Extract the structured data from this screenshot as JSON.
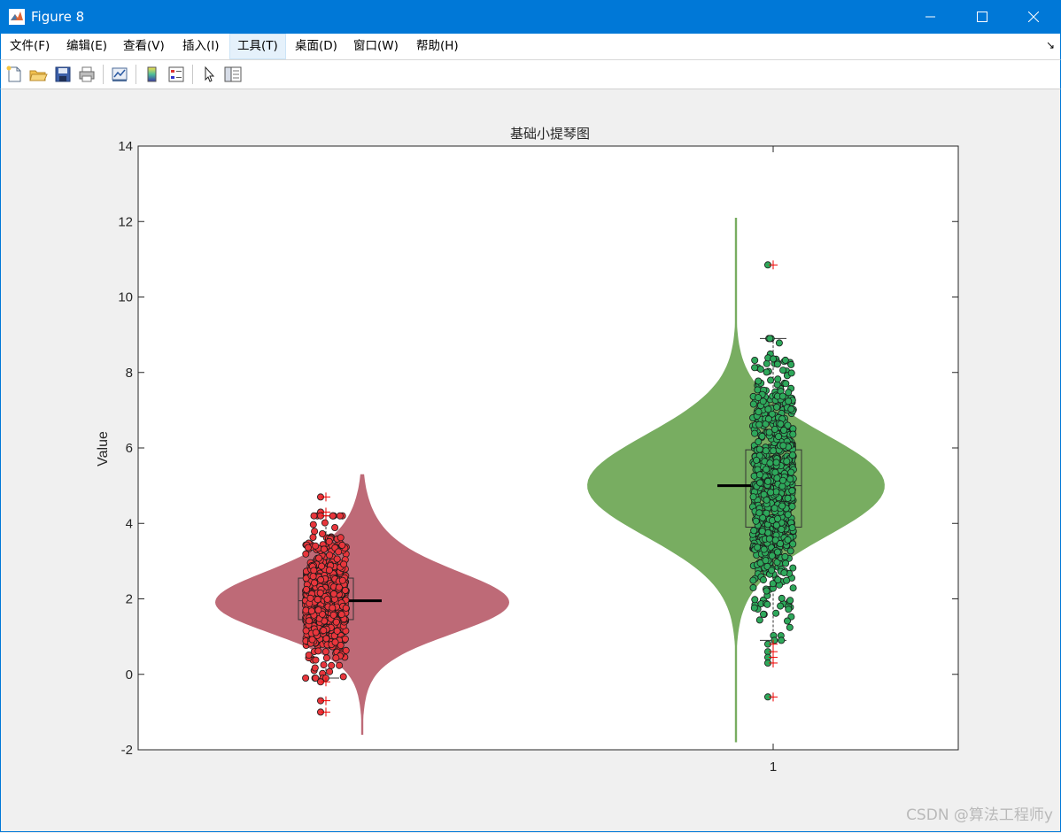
{
  "window": {
    "title": "Figure 8"
  },
  "menu": {
    "items": [
      {
        "label": "文件(F)"
      },
      {
        "label": "编辑(E)"
      },
      {
        "label": "查看(V)"
      },
      {
        "label": "插入(I)"
      },
      {
        "label": "工具(T)",
        "active": true
      },
      {
        "label": "桌面(D)"
      },
      {
        "label": "窗口(W)"
      },
      {
        "label": "帮助(H)"
      }
    ]
  },
  "toolbar": {
    "icons": [
      "new-figure-icon",
      "open-file-icon",
      "save-icon",
      "print-icon",
      "link-plot-icon",
      "colorbar-icon",
      "legend-icon",
      "pointer-icon",
      "property-inspector-icon"
    ]
  },
  "chart_data": {
    "type": "violin",
    "title": "基础小提琴图",
    "ylabel": "Value",
    "xlabel": "",
    "ylim": [
      -2,
      14
    ],
    "yticks": [
      -2,
      0,
      2,
      4,
      6,
      8,
      10,
      12,
      14
    ],
    "xtick_labels": [
      "1"
    ],
    "grid": false,
    "legend": "none",
    "series": [
      {
        "color": "#be6a77",
        "point_color": "#e8363c",
        "distribution_range": [
          -1.6,
          5.3
        ],
        "mode": 1.85,
        "box": {
          "q1": 1.45,
          "median": 1.95,
          "q3": 2.55,
          "whisker_low": -0.1,
          "whisker_high": 4.2
        },
        "mean": 1.95,
        "outliers": [
          4.7,
          4.3,
          4.2,
          -0.2,
          -0.7,
          -1.0
        ]
      },
      {
        "color": "#78ad61",
        "point_color": "#2ea85b",
        "distribution_range": [
          -1.8,
          12.1
        ],
        "mode": 5.0,
        "box": {
          "q1": 3.9,
          "median": 5.0,
          "q3": 5.95,
          "whisker_low": 0.9,
          "whisker_high": 8.9
        },
        "mean": 5.0,
        "outliers": [
          10.85,
          0.8,
          0.6,
          0.45,
          0.3,
          -0.6
        ]
      }
    ]
  },
  "watermark": "CSDN @算法工程师y"
}
